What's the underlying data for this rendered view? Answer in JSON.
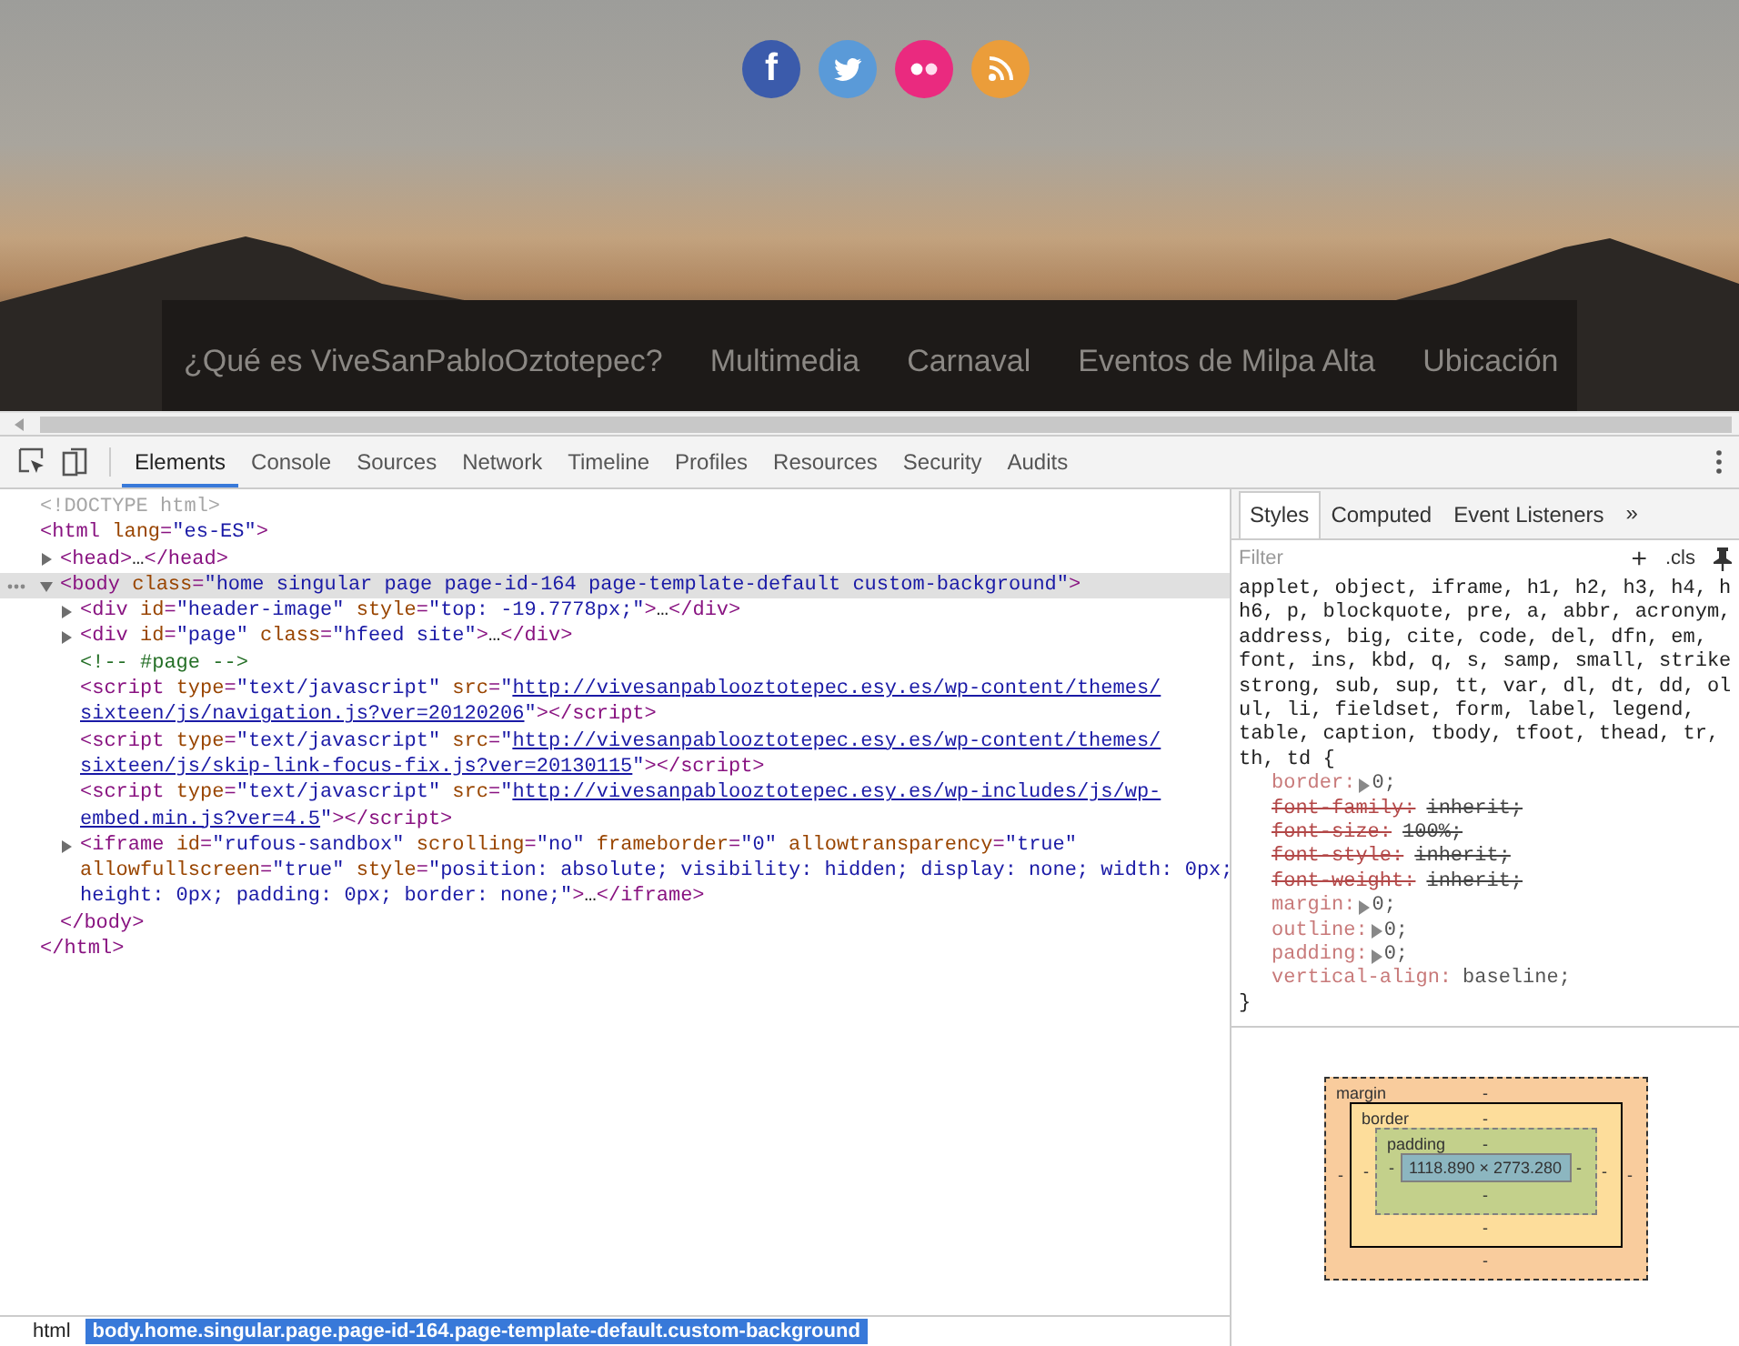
{
  "site": {
    "social": [
      {
        "kind": "facebook",
        "color": "#3b5bab",
        "glyph": "f"
      },
      {
        "kind": "twitter",
        "color": "#5a9ad8"
      },
      {
        "kind": "flickr",
        "color": "#ea2a7f"
      },
      {
        "kind": "rss",
        "color": "#eb9d3a"
      }
    ],
    "nav": [
      {
        "label": "¿Qué es ViveSanPabloOztotepec?"
      },
      {
        "label": "Multimedia"
      },
      {
        "label": "Carnaval"
      },
      {
        "label": "Eventos de Milpa Alta"
      },
      {
        "label": "Ubicación"
      }
    ]
  },
  "devtools": {
    "tabs": [
      {
        "label": "Elements",
        "selected": true
      },
      {
        "label": "Console",
        "selected": false
      },
      {
        "label": "Sources",
        "selected": false
      },
      {
        "label": "Network",
        "selected": false
      },
      {
        "label": "Timeline",
        "selected": false
      },
      {
        "label": "Profiles",
        "selected": false
      },
      {
        "label": "Resources",
        "selected": false
      },
      {
        "label": "Security",
        "selected": false
      },
      {
        "label": "Audits",
        "selected": false
      }
    ]
  },
  "dom_tree": [
    {
      "selected": false,
      "lines": [
        [
          {
            "kind": "doctype",
            "text": "<!DOCTYPE html>"
          }
        ]
      ]
    },
    {
      "selected": false,
      "lines": [
        [
          {
            "kind": "tag",
            "text": "<html"
          },
          {
            "kind": "attr",
            "text": " lang"
          },
          {
            "kind": "tag",
            "text": "="
          },
          {
            "kind": "value",
            "text": "\"es-ES\""
          },
          {
            "kind": "tag",
            "text": ">"
          }
        ]
      ],
      "close": [
        {
          "kind": "tag",
          "text": "</html>"
        }
      ],
      "children": [
        {
          "selected": false,
          "expanded": false,
          "lines": [
            [
              {
                "kind": "tag",
                "text": "<head>"
              },
              {
                "kind": "text",
                "text": "…"
              },
              {
                "kind": "tag",
                "text": "</head>"
              }
            ]
          ]
        },
        {
          "selected": true,
          "expanded": true,
          "lines": [
            [
              {
                "kind": "tag",
                "text": "<body"
              },
              {
                "kind": "attr",
                "text": " class"
              },
              {
                "kind": "tag",
                "text": "="
              },
              {
                "kind": "value",
                "text": "\"home singular page page-id-164 page-template-default custom-background\""
              },
              {
                "kind": "tag",
                "text": ">"
              }
            ]
          ],
          "close": [
            {
              "kind": "tag",
              "text": "</body>"
            }
          ],
          "children": [
            {
              "selected": false,
              "expanded": false,
              "lines": [
                [
                  {
                    "kind": "tag",
                    "text": "<div"
                  },
                  {
                    "kind": "attr",
                    "text": " id"
                  },
                  {
                    "kind": "tag",
                    "text": "="
                  },
                  {
                    "kind": "value",
                    "text": "\"header-image\""
                  },
                  {
                    "kind": "attr",
                    "text": " style"
                  },
                  {
                    "kind": "tag",
                    "text": "="
                  },
                  {
                    "kind": "value",
                    "text": "\"top: -19.7778px;\""
                  },
                  {
                    "kind": "tag",
                    "text": ">"
                  },
                  {
                    "kind": "text",
                    "text": "…"
                  },
                  {
                    "kind": "tag",
                    "text": "</div>"
                  }
                ]
              ]
            },
            {
              "selected": false,
              "expanded": false,
              "lines": [
                [
                  {
                    "kind": "tag",
                    "text": "<div"
                  },
                  {
                    "kind": "attr",
                    "text": " id"
                  },
                  {
                    "kind": "tag",
                    "text": "="
                  },
                  {
                    "kind": "value",
                    "text": "\"page\""
                  },
                  {
                    "kind": "attr",
                    "text": " class"
                  },
                  {
                    "kind": "tag",
                    "text": "="
                  },
                  {
                    "kind": "value",
                    "text": "\"hfeed site\""
                  },
                  {
                    "kind": "tag",
                    "text": ">"
                  },
                  {
                    "kind": "text",
                    "text": "…"
                  },
                  {
                    "kind": "tag",
                    "text": "</div>"
                  }
                ]
              ]
            },
            {
              "selected": false,
              "lines": [
                [
                  {
                    "kind": "comment",
                    "text": "<!-- #page -->"
                  }
                ]
              ]
            },
            {
              "selected": false,
              "lines": [
                [
                  {
                    "kind": "tag",
                    "text": "<script"
                  },
                  {
                    "kind": "attr",
                    "text": " type"
                  },
                  {
                    "kind": "tag",
                    "text": "="
                  },
                  {
                    "kind": "value",
                    "text": "\"text/javascript\""
                  },
                  {
                    "kind": "attr",
                    "text": " src"
                  },
                  {
                    "kind": "tag",
                    "text": "="
                  },
                  {
                    "kind": "value",
                    "text": "\""
                  },
                  {
                    "kind": "link",
                    "text": "http://vivesanpablooztotepec.esy.es/wp-content/themes/"
                  }
                ],
                [
                  {
                    "kind": "link",
                    "text": "sixteen/js/navigation.js?ver=20120206"
                  },
                  {
                    "kind": "value",
                    "text": "\""
                  },
                  {
                    "kind": "tag",
                    "text": "></script>"
                  }
                ]
              ]
            },
            {
              "selected": false,
              "lines": [
                [
                  {
                    "kind": "tag",
                    "text": "<script"
                  },
                  {
                    "kind": "attr",
                    "text": " type"
                  },
                  {
                    "kind": "tag",
                    "text": "="
                  },
                  {
                    "kind": "value",
                    "text": "\"text/javascript\""
                  },
                  {
                    "kind": "attr",
                    "text": " src"
                  },
                  {
                    "kind": "tag",
                    "text": "="
                  },
                  {
                    "kind": "value",
                    "text": "\""
                  },
                  {
                    "kind": "link",
                    "text": "http://vivesanpablooztotepec.esy.es/wp-content/themes/"
                  }
                ],
                [
                  {
                    "kind": "link",
                    "text": "sixteen/js/skip-link-focus-fix.js?ver=20130115"
                  },
                  {
                    "kind": "value",
                    "text": "\""
                  },
                  {
                    "kind": "tag",
                    "text": "></script>"
                  }
                ]
              ]
            },
            {
              "selected": false,
              "lines": [
                [
                  {
                    "kind": "tag",
                    "text": "<script"
                  },
                  {
                    "kind": "attr",
                    "text": " type"
                  },
                  {
                    "kind": "tag",
                    "text": "="
                  },
                  {
                    "kind": "value",
                    "text": "\"text/javascript\""
                  },
                  {
                    "kind": "attr",
                    "text": " src"
                  },
                  {
                    "kind": "tag",
                    "text": "="
                  },
                  {
                    "kind": "value",
                    "text": "\""
                  },
                  {
                    "kind": "link",
                    "text": "http://vivesanpablooztotepec.esy.es/wp-includes/js/wp-"
                  }
                ],
                [
                  {
                    "kind": "link",
                    "text": "embed.min.js?ver=4.5"
                  },
                  {
                    "kind": "value",
                    "text": "\""
                  },
                  {
                    "kind": "tag",
                    "text": "></script>"
                  }
                ]
              ]
            },
            {
              "selected": false,
              "expanded": false,
              "lines": [
                [
                  {
                    "kind": "tag",
                    "text": "<iframe"
                  },
                  {
                    "kind": "attr",
                    "text": " id"
                  },
                  {
                    "kind": "tag",
                    "text": "="
                  },
                  {
                    "kind": "value",
                    "text": "\"rufous-sandbox\""
                  },
                  {
                    "kind": "attr",
                    "text": " scrolling"
                  },
                  {
                    "kind": "tag",
                    "text": "="
                  },
                  {
                    "kind": "value",
                    "text": "\"no\""
                  },
                  {
                    "kind": "attr",
                    "text": " frameborder"
                  },
                  {
                    "kind": "tag",
                    "text": "="
                  },
                  {
                    "kind": "value",
                    "text": "\"0\""
                  },
                  {
                    "kind": "attr",
                    "text": " allowtransparency"
                  },
                  {
                    "kind": "tag",
                    "text": "="
                  },
                  {
                    "kind": "value",
                    "text": "\"true\""
                  }
                ],
                [
                  {
                    "kind": "attr",
                    "text": "allowfullscreen"
                  },
                  {
                    "kind": "tag",
                    "text": "="
                  },
                  {
                    "kind": "value",
                    "text": "\"true\""
                  },
                  {
                    "kind": "attr",
                    "text": " style"
                  },
                  {
                    "kind": "tag",
                    "text": "="
                  },
                  {
                    "kind": "value",
                    "text": "\"position: absolute; visibility: hidden; display: none; width: 0px;"
                  }
                ],
                [
                  {
                    "kind": "value",
                    "text": "height: 0px; padding: 0px; border: none;\""
                  },
                  {
                    "kind": "tag",
                    "text": ">"
                  },
                  {
                    "kind": "text",
                    "text": "…"
                  },
                  {
                    "kind": "tag",
                    "text": "</iframe>"
                  }
                ]
              ]
            }
          ]
        }
      ]
    }
  ],
  "breadcrumbs": [
    {
      "label": "html",
      "selected": false
    },
    {
      "label": "body.home.singular.page.page-id-164.page-template-default.custom-background",
      "selected": true
    }
  ],
  "styles": {
    "tabs": [
      {
        "label": "Styles",
        "selected": true
      },
      {
        "label": "Computed",
        "selected": false
      },
      {
        "label": "Event Listeners",
        "selected": false
      }
    ],
    "more": "»",
    "filter": {
      "placeholder": "Filter"
    },
    "add_rule": "+",
    "cls": ".cls",
    "selector_lines": [
      "applet, object, iframe, h1, h2, h3, h4, h",
      "h6, p, blockquote, pre, a, abbr, acronym,",
      "address, big, cite, code, del, dfn, em,",
      "font, ins, kbd, q, s, samp, small, strike",
      "strong, sub, sup, tt, var, dl, dt, dd, ol",
      "ul, li, fieldset, form, label, legend,",
      "table, caption, tbody, tfoot, thead, tr,",
      "th, td {"
    ],
    "properties": [
      {
        "name": "border:",
        "value": "0;",
        "expandable": true,
        "overridden": false
      },
      {
        "name": "font-family:",
        "value": "inherit;",
        "expandable": false,
        "overridden": true
      },
      {
        "name": "font-size:",
        "value": "100%;",
        "expandable": false,
        "overridden": true
      },
      {
        "name": "font-style:",
        "value": "inherit;",
        "expandable": false,
        "overridden": true
      },
      {
        "name": "font-weight:",
        "value": "inherit;",
        "expandable": false,
        "overridden": true
      },
      {
        "name": "margin:",
        "value": "0;",
        "expandable": true,
        "overridden": false
      },
      {
        "name": "outline:",
        "value": "0;",
        "expandable": true,
        "overridden": false
      },
      {
        "name": "padding:",
        "value": "0;",
        "expandable": true,
        "overridden": false
      },
      {
        "name": "vertical-align:",
        "value": "baseline;",
        "expandable": false,
        "overridden": false
      }
    ],
    "close": "}"
  },
  "box_model": {
    "margin": {
      "label": "margin",
      "top": "-",
      "right": "-",
      "bottom": "-",
      "left": "-"
    },
    "border": {
      "label": "border",
      "top": "-",
      "right": "-",
      "bottom": "-",
      "left": "-"
    },
    "padding": {
      "label": "padding",
      "top": "-",
      "right": "-",
      "bottom": "-",
      "left": "-"
    },
    "content": "1118.890 × 2773.280"
  }
}
